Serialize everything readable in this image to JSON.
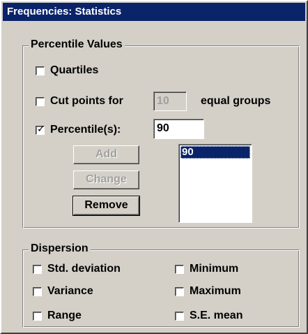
{
  "window": {
    "title": "Frequencies: Statistics"
  },
  "percentile_values": {
    "title": "Percentile Values",
    "quartiles": {
      "label": "Quartiles",
      "checked": false
    },
    "cut_points": {
      "label": "Cut points for",
      "value": "10",
      "suffix": "equal groups",
      "checked": false
    },
    "percentiles": {
      "label": "Percentile(s):",
      "value": "90",
      "checked": true
    },
    "buttons": {
      "add": "Add",
      "change": "Change",
      "remove": "Remove"
    },
    "list": [
      "90"
    ]
  },
  "dispersion": {
    "title": "Dispersion",
    "items": [
      {
        "label": "Std. deviation",
        "checked": false
      },
      {
        "label": "Minimum",
        "checked": false
      },
      {
        "label": "Variance",
        "checked": false
      },
      {
        "label": "Maximum",
        "checked": false
      },
      {
        "label": "Range",
        "checked": false
      },
      {
        "label": "S.E. mean",
        "checked": false
      }
    ]
  },
  "colors": {
    "titlebar": "#0a246a",
    "face": "#d4d0c8",
    "selection": "#0a246a"
  }
}
